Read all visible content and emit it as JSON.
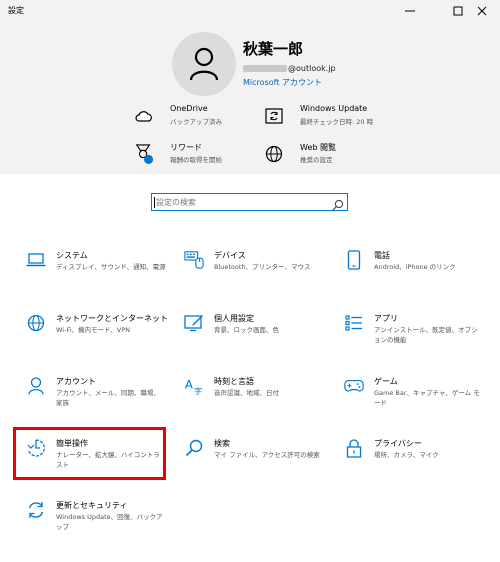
{
  "window": {
    "title": "設定"
  },
  "account": {
    "name": "秋葉一郎",
    "email_suffix": "@outlook.jp",
    "account_link": "Microsoft アカウント"
  },
  "quick_links": [
    {
      "title": "OneDrive",
      "subtitle": "バックアップ済み",
      "icon": "cloud-icon"
    },
    {
      "title": "Windows Update",
      "subtitle": "最終チェック日時: 20 時",
      "icon": "update-icon"
    },
    {
      "title": "リワード",
      "subtitle": "報酬の取得を開始",
      "icon": "rewards-icon"
    },
    {
      "title": "Web 閲覧",
      "subtitle": "推奨の設定",
      "icon": "globe-icon"
    }
  ],
  "search": {
    "placeholder": "設定の検索"
  },
  "categories": [
    {
      "title": "システム",
      "subtitle": "ディスプレイ、サウンド、通知、電源",
      "icon": "laptop-icon"
    },
    {
      "title": "デバイス",
      "subtitle": "Bluetooth、プリンター、マウス",
      "icon": "keyboard-icon"
    },
    {
      "title": "電話",
      "subtitle": "Android、iPhone のリンク",
      "icon": "phone-icon"
    },
    {
      "title": "ネットワークとインターネット",
      "subtitle": "Wi-Fi、機内モード、VPN",
      "icon": "globe-icon"
    },
    {
      "title": "個人用設定",
      "subtitle": "背景、ロック画面、色",
      "icon": "personalization-icon"
    },
    {
      "title": "アプリ",
      "subtitle": "アンインストール、既定値、オプションの機能",
      "icon": "apps-icon"
    },
    {
      "title": "アカウント",
      "subtitle": "アカウント、メール、同期、職場、家族",
      "icon": "person-icon"
    },
    {
      "title": "時刻と言語",
      "subtitle": "音声認識、地域、日付",
      "icon": "time-language-icon"
    },
    {
      "title": "ゲーム",
      "subtitle": "Game Bar、キャプチャ、ゲーム モード",
      "icon": "gamepad-icon"
    },
    {
      "title": "簡単操作",
      "subtitle": "ナレーター、拡大鏡、ハイコントラスト",
      "icon": "ease-of-access-icon"
    },
    {
      "title": "検索",
      "subtitle": "マイ ファイル、アクセス許可の検索",
      "icon": "search-icon"
    },
    {
      "title": "プライバシー",
      "subtitle": "場所、カメラ、マイク",
      "icon": "lock-icon"
    },
    {
      "title": "更新とセキュリティ",
      "subtitle": "Windows Update、回復、バックアップ",
      "icon": "sync-icon"
    }
  ],
  "colors": {
    "accent": "#0078d7",
    "header_bg": "#f2f2f2",
    "highlight": "#e00000"
  }
}
